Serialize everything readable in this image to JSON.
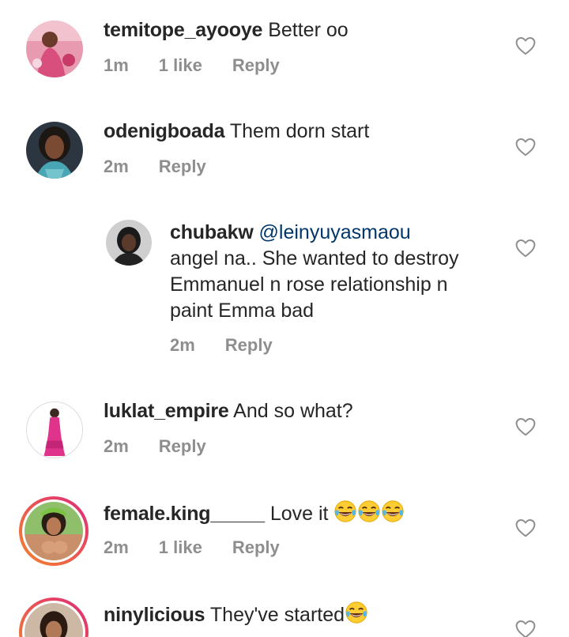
{
  "comments": [
    {
      "username": "temitope_ayooye",
      "text": "Better oo",
      "time": "1m",
      "likes": "1 like",
      "reply_label": "Reply",
      "avatar_icon": "user-avatar-photo"
    },
    {
      "username": "odenigboada",
      "text": "Them dorn start",
      "time": "2m",
      "reply_label": "Reply",
      "avatar_icon": "user-avatar-photo"
    },
    {
      "username": "chubakw",
      "mention": "@leinyuyasmaou",
      "text_line1": "angel na.. She wanted to destroy",
      "text_line2": "Emmanuel n rose relationship n",
      "text_line3": "paint Emma bad",
      "time": "2m",
      "reply_label": "Reply",
      "avatar_icon": "user-avatar-photo"
    },
    {
      "username": "luklat_empire",
      "text": "And so what?",
      "time": "2m",
      "reply_label": "Reply",
      "avatar_icon": "user-avatar-photo"
    },
    {
      "username": "female.king_____",
      "text": "Love it",
      "emoji": "face-with-tears-of-joy x3",
      "time": "2m",
      "likes": "1 like",
      "reply_label": "Reply",
      "avatar_icon": "user-avatar-photo-with-story-ring"
    },
    {
      "username": "ninylicious",
      "text": "They've started",
      "emoji": "face-with-tears-of-joy",
      "avatar_icon": "user-avatar-photo-with-story-ring"
    }
  ],
  "colors": {
    "text": "#262626",
    "meta": "#8e8e8e",
    "mention": "#00376b",
    "story_ring_start": "#f58529",
    "story_ring_end": "#dd2a7b"
  },
  "icons": {
    "like": "heart-outline-icon",
    "emoji": "face-with-tears-of-joy"
  }
}
